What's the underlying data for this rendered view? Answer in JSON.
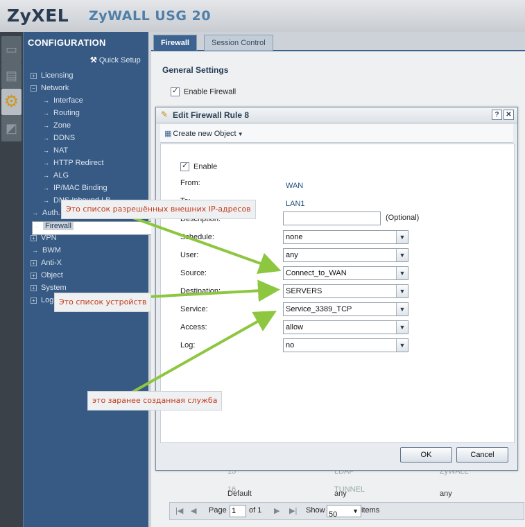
{
  "header": {
    "brand": "ZyXEL",
    "model": "ZyWALL USG 20"
  },
  "sidebar": {
    "title": "CONFIGURATION",
    "quick_setup": "Quick Setup",
    "items": [
      {
        "label": "Licensing"
      },
      {
        "label": "Network"
      },
      {
        "label": "Interface"
      },
      {
        "label": "Routing"
      },
      {
        "label": "Zone"
      },
      {
        "label": "DDNS"
      },
      {
        "label": "NAT"
      },
      {
        "label": "HTTP Redirect"
      },
      {
        "label": "ALG"
      },
      {
        "label": "IP/MAC Binding"
      },
      {
        "label": "DNS Inbound LB"
      },
      {
        "label": "Auth. Policy"
      },
      {
        "label": "Firewall"
      },
      {
        "label": "VPN"
      },
      {
        "label": "BWM"
      },
      {
        "label": "Anti-X"
      },
      {
        "label": "Object"
      },
      {
        "label": "System"
      },
      {
        "label": "Log & Report"
      }
    ]
  },
  "tabs": [
    {
      "label": "Firewall"
    },
    {
      "label": "Session Control"
    }
  ],
  "general": {
    "title": "General Settings",
    "enable_firewall": "Enable Firewall"
  },
  "background_table": {
    "rows": [
      {
        "num": "15",
        "service": "LDAP",
        "zone": "ZyWALL"
      },
      {
        "num": "16",
        "service": "TUNNEL",
        "zone": ""
      }
    ],
    "default_row": {
      "label": "Default",
      "col2": "any",
      "col3": "any"
    }
  },
  "pager": {
    "page_label": "Page",
    "page": "1",
    "of": "of 1",
    "show": "Show",
    "count": "50",
    "items": "items"
  },
  "dialog": {
    "title": "Edit Firewall Rule 8",
    "create_object": "Create new Object",
    "enable": "Enable",
    "from_label": "From:",
    "from_value": "WAN",
    "to_label": "To:",
    "to_value": "LAN1",
    "description_label": "Description:",
    "description_value": "",
    "optional": "(Optional)",
    "schedule_label": "Schedule:",
    "schedule_value": "none",
    "user_label": "User:",
    "user_value": "any",
    "source_label": "Source:",
    "source_value": "Connect_to_WAN",
    "destination_label": "Destination:",
    "destination_value": "SERVERS",
    "service_label": "Service:",
    "service_value": "Service_3389_TCP",
    "access_label": "Access:",
    "access_value": "allow",
    "log_label": "Log:",
    "log_value": "no",
    "ok": "OK",
    "cancel": "Cancel"
  },
  "annotations": {
    "ip_list": "Это список разрешённых внешних IP-адресов",
    "device_list": "Это список устройств",
    "service": "это заранее созданная служба",
    "color": "#8dc63f"
  }
}
